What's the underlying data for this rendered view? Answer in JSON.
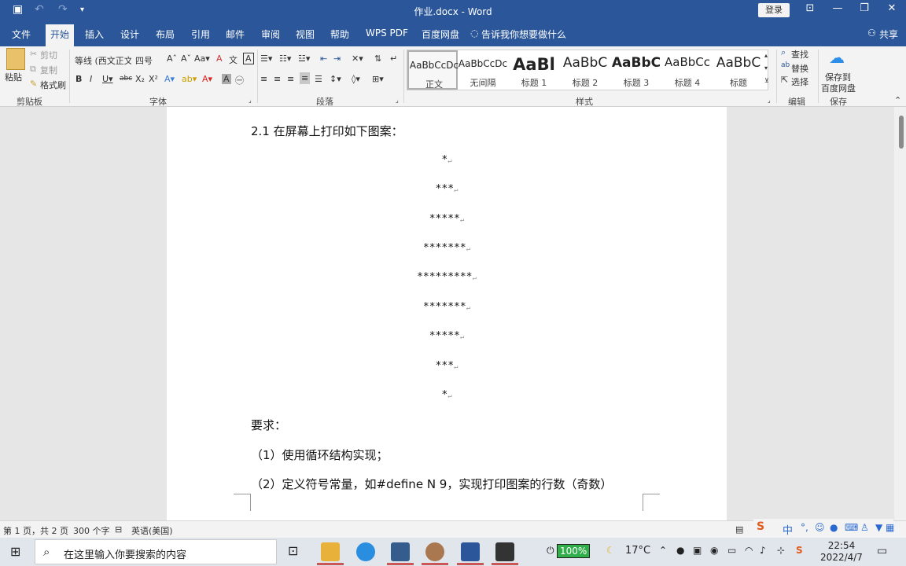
{
  "titlebar": {
    "title": "作业.docx  -  Word",
    "login": "登录"
  },
  "tabs": [
    "文件",
    "开始",
    "插入",
    "设计",
    "布局",
    "引用",
    "邮件",
    "审阅",
    "视图",
    "帮助",
    "WPS PDF",
    "百度网盘",
    "告诉我你想要做什么"
  ],
  "share": "共享",
  "clipboard": {
    "paste": "粘贴",
    "cut": "剪切",
    "copy": "复制",
    "format_painter": "格式刷",
    "group": "剪贴板"
  },
  "font": {
    "name": "等线 (西文正文",
    "size": "四号",
    "group": "字体"
  },
  "paragraph": {
    "group": "段落"
  },
  "styles": {
    "group": "样式",
    "items": [
      {
        "preview": "AaBbCcDc",
        "label": "正文"
      },
      {
        "preview": "AaBbCcDc",
        "label": "无间隔"
      },
      {
        "preview": "AaBl",
        "label": "标题 1"
      },
      {
        "preview": "AaBbC",
        "label": "标题 2"
      },
      {
        "preview": "AaBbC",
        "label": "标题 3"
      },
      {
        "preview": "AaBbCc",
        "label": "标题 4"
      },
      {
        "preview": "AaBbC",
        "label": "标题"
      }
    ]
  },
  "editing": {
    "find": "查找",
    "replace": "替换",
    "select": "选择",
    "group": "编辑"
  },
  "save": {
    "line1": "保存到",
    "line2": "百度网盘",
    "group": "保存"
  },
  "document": {
    "heading": "2.1  在屏幕上打印如下图案：",
    "pattern": [
      "*",
      "***",
      "*****",
      "*******",
      "*********",
      "*******",
      "*****",
      "***",
      "*"
    ],
    "requirement": "要求：",
    "req1": "（1）使用循环结构实现；",
    "req2": "（2）定义符号常量，如#define N 9，实现打印图案的行数（奇数）"
  },
  "status": {
    "page": "第 1 页，共 2 页",
    "words": "300 个字",
    "lang": "英语(美国)"
  },
  "taskbar": {
    "search_placeholder": "在这里输入你要搜索的内容",
    "battery": "100%",
    "temp": "17°C",
    "ime": "中",
    "time": "22:54",
    "date": "2022/4/7"
  }
}
